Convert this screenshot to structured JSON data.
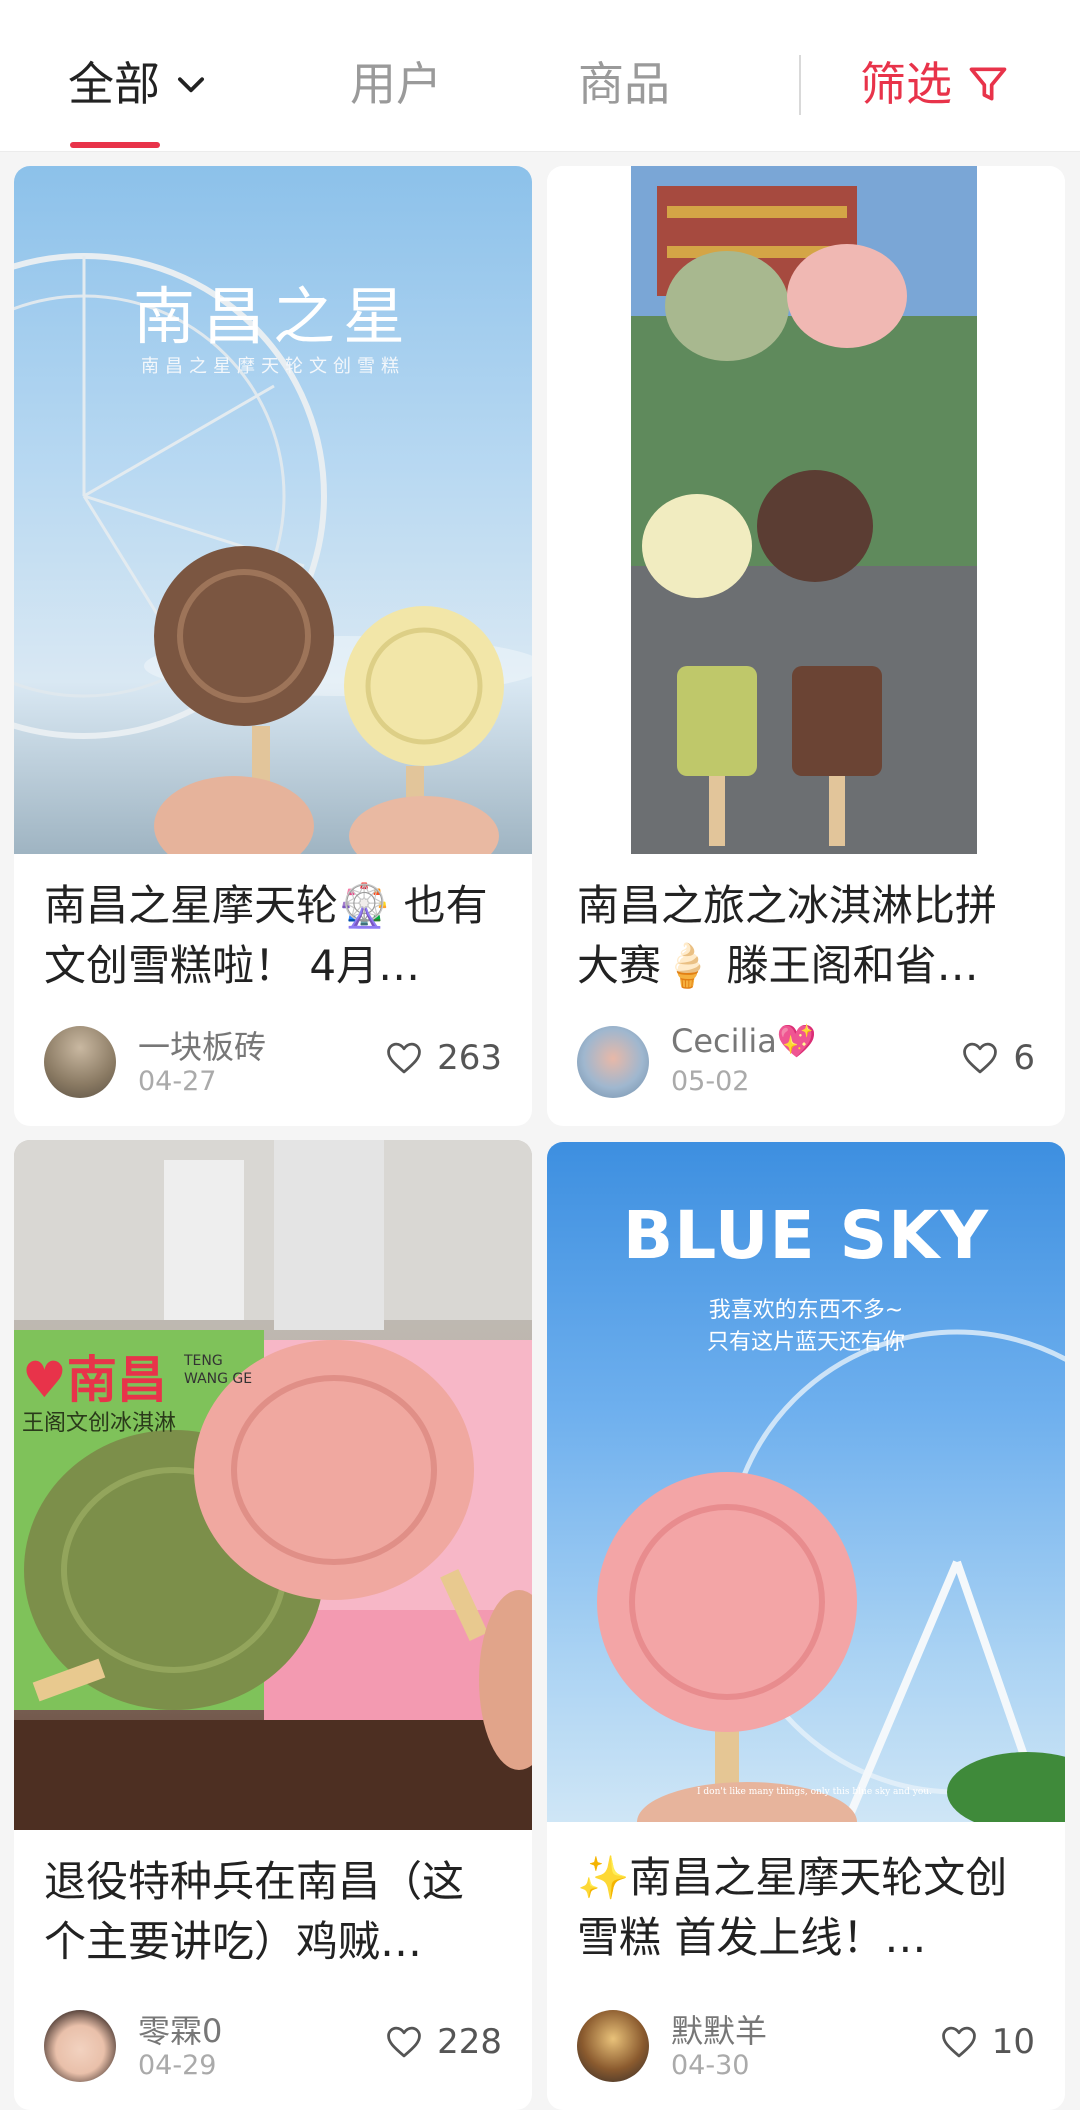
{
  "tabs": {
    "all": "全部",
    "users": "用户",
    "goods": "商品",
    "filter": "筛选"
  },
  "colors": {
    "accent": "#e8334a"
  },
  "posts": [
    {
      "image_title": "南昌之星",
      "image_subtitle": "南昌之星摩天轮文创雪糕",
      "title": "南昌之星摩天轮🎡 也有文创雪糕啦！ 4月…",
      "author": "一块板砖",
      "date": "04-27",
      "likes": "263"
    },
    {
      "title": "南昌之旅之冰淇淋比拼大赛🍦 滕王阁和省…",
      "author": "Cecilia💖",
      "date": "05-02",
      "likes": "6"
    },
    {
      "image_box_label": "♥南昌",
      "image_box_brand": "TENG WANG GE",
      "image_box_text": "王阁文创冰淇淋",
      "title": "退役特种兵在南昌（这个主要讲吃）鸡贼…",
      "author": "零霖0",
      "date": "04-29",
      "likes": "228"
    },
    {
      "image_title": "BLUE SKY",
      "image_line1": "我喜欢的东西不多~",
      "image_line2": "只有这片蓝天还有你",
      "image_caption": "I don't like many things, only this blue sky and you.",
      "title": "✨南昌之星摩天轮文创雪糕 首发上线！…",
      "author": "默默羊",
      "date": "04-30",
      "likes": "10"
    }
  ]
}
